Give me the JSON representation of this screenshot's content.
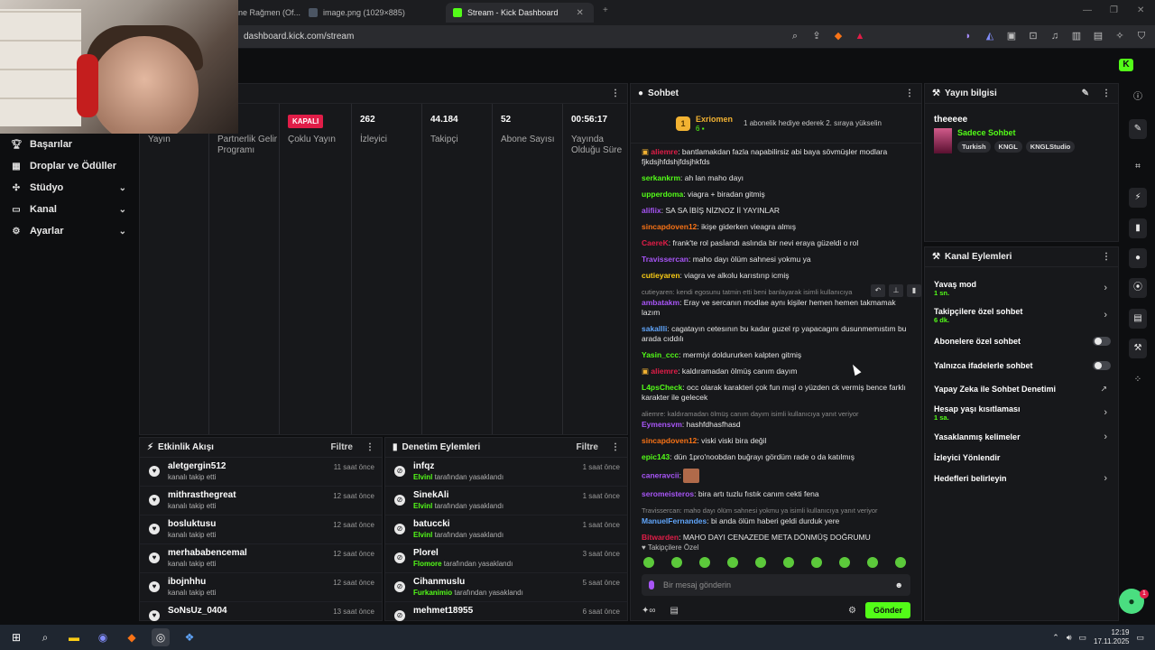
{
  "browser": {
    "tabs": [
      {
        "label": "ne Rağmen (Of..."
      },
      {
        "label": "image.png (1029×885)"
      },
      {
        "label": "Stream - Kick Dashboard"
      }
    ],
    "url": "dashboard.kick.com/stream"
  },
  "sidebar": {
    "items": [
      {
        "label": "Başarılar",
        "icon": "trophy-icon"
      },
      {
        "label": "Droplar ve Ödüller",
        "icon": "gift-icon"
      },
      {
        "label": "Stüdyo",
        "icon": "studio-icon"
      },
      {
        "label": "Kanal",
        "icon": "tv-icon"
      },
      {
        "label": "Ayarlar",
        "icon": "gear-icon"
      }
    ]
  },
  "stats": [
    {
      "value": "",
      "label": "Yayın"
    },
    {
      "value": "",
      "label": "Partnerlik Gelir Programı"
    },
    {
      "value": "KAPALI",
      "label": "Çoklu Yayın"
    },
    {
      "value": "262",
      "label": "İzleyici"
    },
    {
      "value": "44.184",
      "label": "Takipçi"
    },
    {
      "value": "52",
      "label": "Abone Sayısı"
    },
    {
      "value": "00:56:17",
      "label": "Yayında Olduğu Süre"
    }
  ],
  "activity": {
    "title": "Etkinlik Akışı",
    "filter": "Filtre",
    "items": [
      {
        "user": "aletgergin512",
        "text": "kanalı takip etti",
        "time": "11 saat önce"
      },
      {
        "user": "mithrasthegreat",
        "text": "kanalı takip etti",
        "time": "12 saat önce"
      },
      {
        "user": "bosluktusu",
        "text": "kanalı takip etti",
        "time": "12 saat önce"
      },
      {
        "user": "merhababencemal",
        "text": "kanalı takip etti",
        "time": "12 saat önce"
      },
      {
        "user": "ibojnhhu",
        "text": "kanalı takip etti",
        "time": "12 saat önce"
      },
      {
        "user": "SoNsUz_0404",
        "text": "",
        "time": "13 saat önce"
      }
    ]
  },
  "moderation": {
    "title": "Denetim Eylemleri",
    "filter": "Filtre",
    "items": [
      {
        "user": "infqz",
        "mod": "Elvinl",
        "text": "tarafından yasaklandı",
        "time": "1 saat önce"
      },
      {
        "user": "SinekAli",
        "mod": "Elvinl",
        "text": "tarafından yasaklandı",
        "time": "1 saat önce"
      },
      {
        "user": "batuccki",
        "mod": "Elvinl",
        "text": "tarafından yasaklandı",
        "time": "1 saat önce"
      },
      {
        "user": "Plorel",
        "mod": "Flomore",
        "text": "tarafından yasaklandı",
        "time": "3 saat önce"
      },
      {
        "user": "Cihanmuslu",
        "mod": "Furkanimio",
        "text": "tarafından yasaklandı",
        "time": "5 saat önce"
      },
      {
        "user": "mehmet18955",
        "mod": "",
        "text": "",
        "time": "6 saat önce"
      }
    ]
  },
  "chat": {
    "title": "Sohbet",
    "pinned": {
      "name": "Exriomen",
      "count": "6",
      "text": "1 abonelik hediye ederek 2. sıraya yükselin"
    },
    "messages": [
      {
        "user": "aliemre",
        "color": "#e11d48",
        "text": "bantlamakdan fazla napabilirsiz abi baya sövmüşler modlara fjkdsjhfdshjfdsjhkfds",
        "reply": ""
      },
      {
        "user": "serkankrm",
        "color": "#53fc18",
        "text": "ah lan maho dayı",
        "reply": ""
      },
      {
        "user": "upperdoma",
        "color": "#53fc18",
        "text": "viagra + biradan gitmiş",
        "reply": ""
      },
      {
        "user": "alifiix",
        "color": "#a855f7",
        "text": "SA SA İBİŞ NİZNOZ İİ YAYINLAR",
        "reply": ""
      },
      {
        "user": "sincapdoven12",
        "color": "#f97316",
        "text": "ikişe giderken vieagra almış",
        "reply": ""
      },
      {
        "user": "CaereK",
        "color": "#e11d48",
        "text": "frank'te rol pasİandı aslında bir nevi eraya güzeldi o rol",
        "reply": ""
      },
      {
        "user": "Travissercan",
        "color": "#a855f7",
        "text": "maho dayı ölüm sahnesi yokmu ya",
        "reply": ""
      },
      {
        "user": "cutieyaren",
        "color": "#facc15",
        "text": "viagra ve alkolu karıstırıp icmiş",
        "reply": ""
      },
      {
        "user": "ambatakm",
        "color": "#a855f7",
        "text": "Eray ve sercanın modlae aynı kişiler hemen hemen takmamak lazım",
        "reply": "cutieyaren: kendi egosunu tatmin etti beni banlayarak isimli kullanıcıya"
      },
      {
        "user": "sakallli",
        "color": "#60a5fa",
        "text": "cagatayın cetesının bu kadar guzel rp yapacagını dusunmemıstım bu arada cıddılı",
        "reply": ""
      },
      {
        "user": "Yasin_ccc",
        "color": "#53fc18",
        "text": "mermiyi doldururken kalpten gitmiş",
        "reply": ""
      },
      {
        "user": "aliemre",
        "color": "#e11d48",
        "text": "kaldıramadan ölmüş canım dayım",
        "reply": ""
      },
      {
        "user": "L4psCheck",
        "color": "#53fc18",
        "text": "occ olarak karakteri çok fun mışl o yüzden ck vermiş bence farklı karakter ile gelecek",
        "reply": ""
      },
      {
        "user": "Eymensvm",
        "color": "#a855f7",
        "text": "hashfdhasfhasd",
        "reply": "aliemre: kaldıramadan ölmüş canım dayım isimli kullanıcıya yanıt veriyor"
      },
      {
        "user": "sincapdoven12",
        "color": "#f97316",
        "text": "viski viski bira değil",
        "reply": ""
      },
      {
        "user": "epic143",
        "color": "#53fc18",
        "text": "dün 1pro'noobdan buğrayı gördüm rade o da katılmış",
        "reply": ""
      },
      {
        "user": "caneravcii",
        "color": "#a855f7",
        "text": "",
        "reply": ""
      },
      {
        "user": "seromeisteros",
        "color": "#a855f7",
        "text": "bira artı tuzlu fıstık canım cekti fena",
        "reply": ""
      },
      {
        "user": "ManuelFernandes",
        "color": "#60a5fa",
        "text": "bi anda ölüm haberi geldi durduk yere",
        "reply": "Travissercan: maho dayı ölüm sahnesi yokmu ya isimli kullanıcıya yanıt veriyor"
      },
      {
        "user": "Bitwarden",
        "color": "#e11d48",
        "text": "MAHO DAYI CENAZEDE META DÖNMÜŞ DOĞRUMU",
        "reply": ""
      }
    ],
    "subs_only": "Takipçilere Özel",
    "input_placeholder": "Bir mesaj gönderin",
    "send_label": "Gönder"
  },
  "stream_info": {
    "title": "Yayın bilgisi",
    "stream_title": "theeeee",
    "category": "Sadece Sohbet",
    "tags": [
      "Turkish",
      "KNGL",
      "KNGLStudio"
    ]
  },
  "channel_actions": {
    "title": "Kanal Eylemleri",
    "items": [
      {
        "label": "Yavaş mod",
        "sub": "1 sn.",
        "control": "chevron"
      },
      {
        "label": "Takipçilere özel sohbet",
        "sub": "6 dk.",
        "control": "chevron"
      },
      {
        "label": "Abonelere özel sohbet",
        "sub": "",
        "control": "toggle"
      },
      {
        "label": "Yalnızca ifadelerle sohbet",
        "sub": "",
        "control": "toggle"
      },
      {
        "label": "Yapay Zeka ile Sohbet Denetimi",
        "sub": "",
        "control": "external"
      },
      {
        "label": "Hesap yaşı kısıtlaması",
        "sub": "1 sa.",
        "control": "chevron"
      },
      {
        "label": "Yasaklanmış kelimeler",
        "sub": "",
        "control": "chevron"
      },
      {
        "label": "İzleyici Yönlendir",
        "sub": "",
        "control": "none"
      },
      {
        "label": "Hedefleri belirleyin",
        "sub": "",
        "control": "chevron"
      }
    ]
  },
  "taskbar": {
    "time": "12:19",
    "date": "17.11.2025"
  },
  "colors": {
    "accent": "#53fc18",
    "bg": "#0d0e10",
    "panel": "#17181b"
  }
}
